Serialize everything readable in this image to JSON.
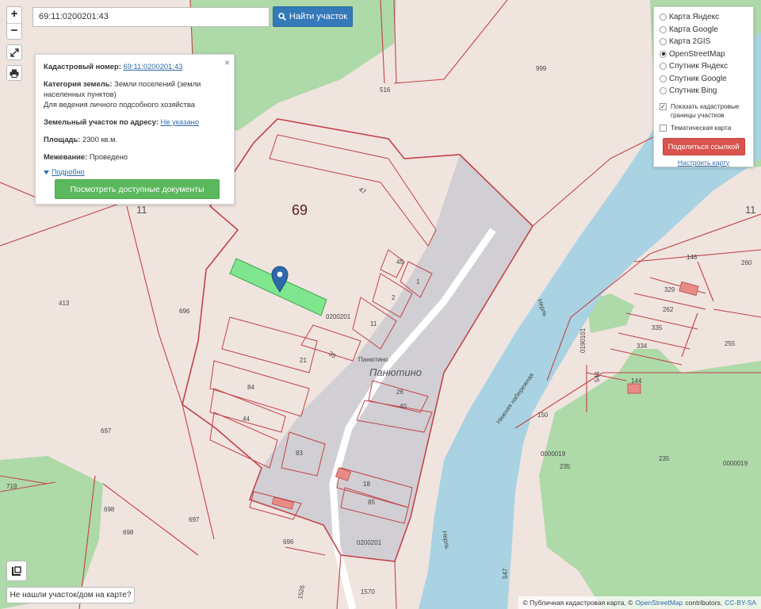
{
  "map": {
    "labels": {
      "parcel_69": "69",
      "block_11_left": "11",
      "block_11_right": "11",
      "block_0200201_a": "0200201",
      "block_0200201_b": "0200201",
      "block_0190101": "0190101",
      "village_small": "Панютино",
      "village_large": "Панютино",
      "block_0000019_a": "0000019",
      "block_0000019_b": "0000019",
      "n999": "999",
      "n516": "516",
      "n47": "47",
      "n45": "45",
      "n1": "1",
      "n2": "2",
      "n11": "11",
      "n35": "35",
      "n21": "21",
      "n84": "84",
      "n44": "44",
      "n83": "83",
      "n26": "26",
      "n40": "40",
      "n18": "18",
      "n85": "85",
      "n413": "413",
      "n696a": "696",
      "n696b": "696",
      "n697a": "697",
      "n697b": "697",
      "n698a": "698",
      "n698b": "698",
      "n719": "719",
      "n146": "146",
      "n260": "260",
      "n329": "329",
      "n262": "262",
      "n335": "335",
      "n334": "334",
      "n255": "255",
      "n144": "144",
      "n150": "150",
      "n235a": "235",
      "n235b": "235",
      "n544": "544",
      "n547": "547",
      "n1570": "1570",
      "n1526": "1526",
      "river": "Нерль",
      "road_name": "Нижняя набережная"
    }
  },
  "controls": {
    "zoom_in": "+",
    "zoom_out": "−",
    "fullscreen_icon": "fullscreen-icon",
    "print_icon": "print-icon"
  },
  "search": {
    "value": "69:11:0200201:43",
    "button_label": "Найти участок",
    "button_icon": "search-icon"
  },
  "info_card": {
    "cadastral_label": "Кадастровый номер:",
    "cadastral_value": "69:11:0200201:43",
    "category_label": "Категория земель:",
    "category_value": "Земли поселений (земли населенных пунктов)",
    "use_value": "Для ведения личного подсобного хозяйства",
    "address_label": "Земельный участок по адресу:",
    "address_value": "Не указано",
    "area_label": "Площадь:",
    "area_value": "2300 кв.м.",
    "survey_label": "Межевание:",
    "survey_value": "Проведено",
    "details_label": "Подробно",
    "docs_button": "Посмотреть доступные документы",
    "close": "×"
  },
  "layers": {
    "options": [
      {
        "label": "Карта Яндекс",
        "selected": false
      },
      {
        "label": "Карта Google",
        "selected": false
      },
      {
        "label": "Карта 2GIS",
        "selected": false
      },
      {
        "label": "OpenStreetMap",
        "selected": true
      },
      {
        "label": "Спутник Яндекс",
        "selected": false
      },
      {
        "label": "Спутник Google",
        "selected": false
      },
      {
        "label": "Спутник Bing",
        "selected": false
      }
    ],
    "show_boundaries_label": "Показать кадастровые границы участков",
    "show_boundaries_checked": true,
    "thematic_label": "Тематическая карта",
    "thematic_checked": false,
    "share_button": "Поделиться ссылкой",
    "setup_link": "Настроить карту"
  },
  "bottom": {
    "not_found_button": "Не нашли участок/дом на карте?"
  },
  "attribution": {
    "prefix": "© Публичная кадастровая карта, ©",
    "osm": "OpenStreetMap",
    "middle": "contributors,",
    "license": "CC-BY-SA"
  },
  "colors": {
    "background": "#f0e4df",
    "forest": "#aed9a8",
    "water": "#a9d3e2",
    "settlement": "#d1cfd4",
    "boundary": "#c1444a",
    "selected_parcel": "#7fe68f",
    "search_button": "#3479b8",
    "docs_button": "#5cb85c",
    "share_button": "#d9534f"
  }
}
